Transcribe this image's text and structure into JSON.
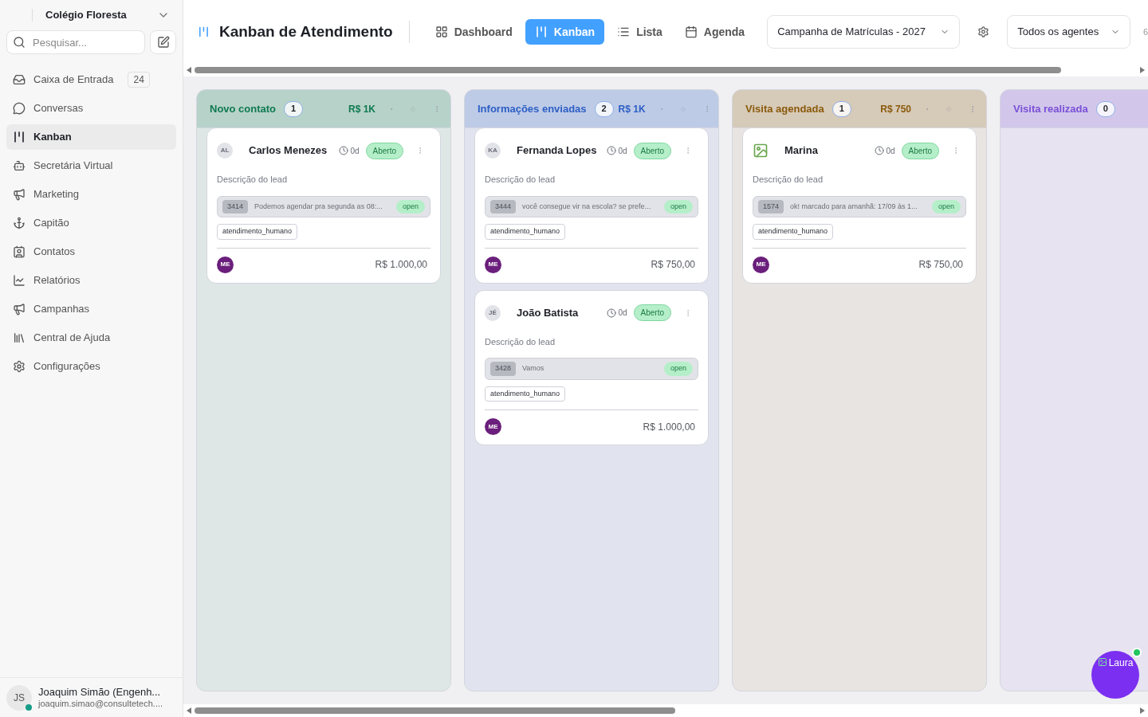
{
  "workspace": {
    "name": "Colégio Floresta"
  },
  "search": {
    "placeholder": "Pesquisar..."
  },
  "nav": [
    {
      "label": "Caixa de Entrada",
      "badge": "24",
      "selected": false
    },
    {
      "label": "Conversas",
      "selected": false
    },
    {
      "label": "Kanban",
      "selected": true
    },
    {
      "label": "Secretária Virtual",
      "selected": false
    },
    {
      "label": "Marketing",
      "selected": false
    },
    {
      "label": "Capitão",
      "selected": false
    },
    {
      "label": "Contatos",
      "selected": false
    },
    {
      "label": "Relatórios",
      "selected": false
    },
    {
      "label": "Campanhas",
      "selected": false
    },
    {
      "label": "Central de Ajuda",
      "selected": false
    },
    {
      "label": "Configurações",
      "selected": false
    }
  ],
  "user": {
    "initials": "JS",
    "name": "Joaquim Simão (Engenh...",
    "email": "joaquim.simao@consultetech....",
    "online": true
  },
  "page_title": "Kanban de Atendimento",
  "views": [
    {
      "label": "Dashboard",
      "selected": false
    },
    {
      "label": "Kanban",
      "selected": true
    },
    {
      "label": "Lista",
      "selected": false
    },
    {
      "label": "Agenda",
      "selected": false
    }
  ],
  "campaign_select": {
    "value": "Campanha de Matrículas - 2027"
  },
  "agent_select": {
    "value": "Todos os agentes"
  },
  "header_overflow": "6",
  "columns": [
    {
      "title": "Novo contato",
      "count": "1",
      "total": "R$ 1K",
      "color": "#0f7a52",
      "cards": [
        {
          "avatar": {
            "kind": "initials",
            "text": "AL"
          },
          "name": "Carlos Menezes",
          "age": "0d",
          "status": "Aberto",
          "description": "Descrição do lead",
          "message": {
            "id": "3414",
            "text": "Podemos agendar pra segunda as 08:...",
            "status": "open"
          },
          "tag": "atendimento_humano",
          "owner": "ME",
          "value": "R$ 1.000,00"
        }
      ]
    },
    {
      "title": "Informações enviadas",
      "count": "2",
      "total": "R$ 1K",
      "color": "#2d5fc4",
      "cards": [
        {
          "avatar": {
            "kind": "initials",
            "text": "KA"
          },
          "name": "Fernanda Lopes",
          "age": "0d",
          "status": "Aberto",
          "description": "Descrição do lead",
          "message": {
            "id": "3444",
            "text": "você consegue vir na escola? se prefe...",
            "status": "open"
          },
          "tag": "atendimento_humano",
          "owner": "ME",
          "value": "R$ 750,00"
        },
        {
          "avatar": {
            "kind": "initials",
            "text": "JÉ"
          },
          "name": "João Batista",
          "age": "0d",
          "status": "Aberto",
          "description": "Descrição do lead",
          "message": {
            "id": "3428",
            "text": "Vamos",
            "status": "open"
          },
          "tag": "atendimento_humano",
          "owner": "ME",
          "value": "R$ 1.000,00"
        }
      ]
    },
    {
      "title": "Visita agendada",
      "count": "1",
      "total": "R$ 750",
      "color": "#8a5a0c",
      "cards": [
        {
          "avatar": {
            "kind": "image"
          },
          "name": "Marina",
          "age": "0d",
          "status": "Aberto",
          "description": "Descrição do lead",
          "message": {
            "id": "1574",
            "text": "ok! marcado para amanhã: 17/09 às 1...",
            "status": "open"
          },
          "tag": "atendimento_humano",
          "owner": "ME",
          "value": "R$ 750,00"
        }
      ]
    },
    {
      "title": "Visita realizada",
      "count": "0",
      "color": "#7a4fd6"
    }
  ],
  "assistant": {
    "label": "Laura",
    "online": true
  }
}
